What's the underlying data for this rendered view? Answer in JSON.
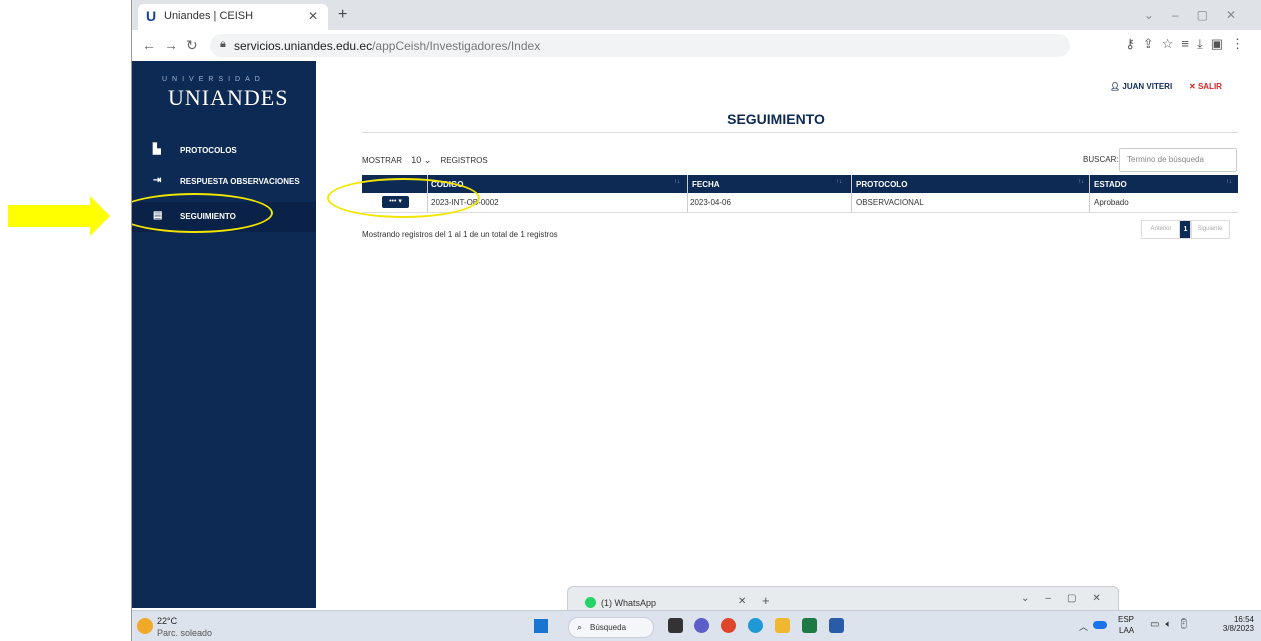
{
  "browser": {
    "tab_title": "Uniandes | CEISH",
    "favicon": "U",
    "url_host": "servicios.uniandes.edu.ec",
    "url_path": "/appCeish/Investigadores/Index"
  },
  "sidebar": {
    "logo_top": "UNIVERSIDAD",
    "logo_main": "UNIANDES",
    "items": [
      {
        "label": "PROTOCOLOS",
        "icon": "pdf-file-icon"
      },
      {
        "label": "RESPUESTA OBSERVACIONES",
        "icon": "file-export-icon"
      },
      {
        "label": "SEGUIMIENTO",
        "icon": "document-icon"
      }
    ]
  },
  "header": {
    "user_name": "JUAN VITERI",
    "logout_label": "SALIR",
    "page_title": "SEGUIMIENTO"
  },
  "controls": {
    "show_label": "MOSTRAR",
    "show_value": "10",
    "records_label": "REGISTROS",
    "search_label": "BUSCAR:",
    "search_placeholder": "Termino de búsqueda"
  },
  "table": {
    "columns": [
      "CODIGO",
      "FECHA",
      "PROTOCOLO",
      "ESTADO"
    ],
    "rows": [
      {
        "codigo": "2023-INT-OB-0002",
        "fecha": "2023-04-06",
        "protocolo": "OBSERVACIONAL",
        "estado": "Aprobado"
      }
    ],
    "action_label": "••• ▾"
  },
  "info": "Mostrando registros del 1 al 1 de un total de 1 registros",
  "pagination": {
    "prev": "Anterior",
    "current": "1",
    "next": "Siguiente"
  },
  "whatsapp_window": {
    "title": "(1) WhatsApp"
  },
  "taskbar": {
    "temperature": "22°C",
    "weather": "Parc. soleado",
    "search_label": "Búsqueda",
    "lang1": "ESP",
    "lang2": "LAA",
    "time": "16:54",
    "date": "3/8/2023"
  },
  "colors": {
    "brand_navy": "#0d2a55",
    "highlight": "#ffff00",
    "logout_red": "#d82323"
  }
}
